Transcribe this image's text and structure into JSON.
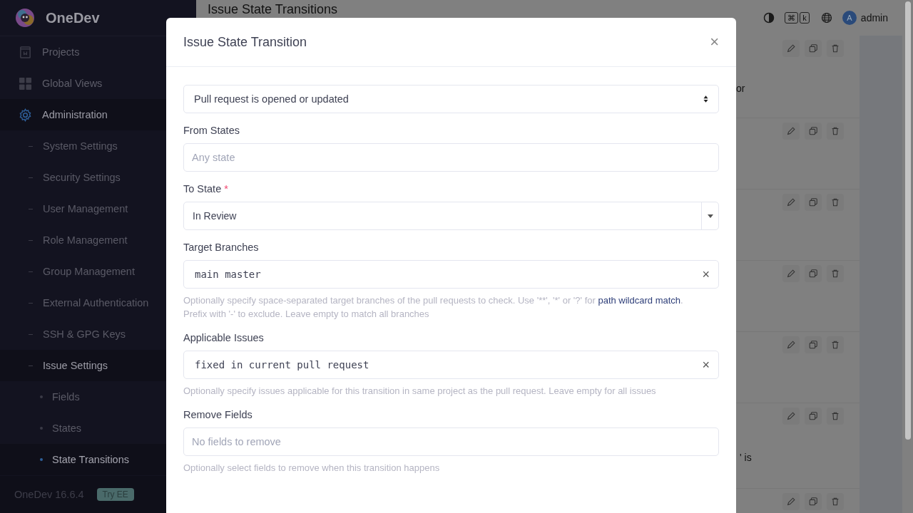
{
  "sidebar": {
    "brand": "OneDev",
    "nav": [
      {
        "label": "Projects",
        "selected": false
      },
      {
        "label": "Global Views",
        "selected": false
      },
      {
        "label": "Administration",
        "selected": true,
        "children": [
          {
            "label": "System Settings",
            "selected": false,
            "expanded": false
          },
          {
            "label": "Security Settings",
            "selected": false,
            "expanded": false
          },
          {
            "label": "User Management",
            "selected": false,
            "expanded": false
          },
          {
            "label": "Role Management",
            "selected": false,
            "expanded": false
          },
          {
            "label": "Group Management",
            "selected": false,
            "expanded": false
          },
          {
            "label": "External Authentication",
            "selected": false,
            "expanded": false
          },
          {
            "label": "SSH & GPG Keys",
            "selected": false,
            "expanded": false
          },
          {
            "label": "Issue Settings",
            "selected": false,
            "expanded": true,
            "children": [
              {
                "label": "Fields",
                "selected": false
              },
              {
                "label": "States",
                "selected": false
              },
              {
                "label": "State Transitions",
                "selected": true
              }
            ]
          }
        ]
      }
    ],
    "version": "OneDev 16.6.4",
    "badge": "Try EE"
  },
  "header": {
    "title": "Issue State Transitions",
    "shortcut": [
      "⌘",
      "k"
    ],
    "user": {
      "initial": "A",
      "name": "admin"
    }
  },
  "rows": [
    {
      "fragment": "or"
    },
    {},
    {},
    {},
    {},
    {
      "fragment": "' is"
    },
    {}
  ],
  "dialog": {
    "title": "Issue State Transition",
    "close": "×",
    "event": "Pull request is opened or updated",
    "fields": [
      {
        "kind": "input",
        "label": "From States",
        "placeholder": "Any state"
      },
      {
        "kind": "select",
        "label": "To State",
        "required_mark": "*",
        "value": "In Review"
      },
      {
        "kind": "code",
        "label": "Target Branches",
        "value": "main master",
        "clear": "×",
        "help": "Optionally specify space-separated target branches of the pull requests to check. Use '**', '*' or '?' for ",
        "link": "path wildcard match",
        "help_end": ". Prefix with '-' to exclude. Leave empty to match all branches"
      },
      {
        "kind": "code",
        "label": "Applicable Issues",
        "value": "fixed in current pull request",
        "clear": "×",
        "help": "Optionally specify issues applicable for this transition in same project as the pull request. Leave empty for all issues"
      },
      {
        "kind": "input",
        "label": "Remove Fields",
        "placeholder": "No fields to remove",
        "help": "Optionally select fields to remove when this transition happens"
      }
    ]
  }
}
